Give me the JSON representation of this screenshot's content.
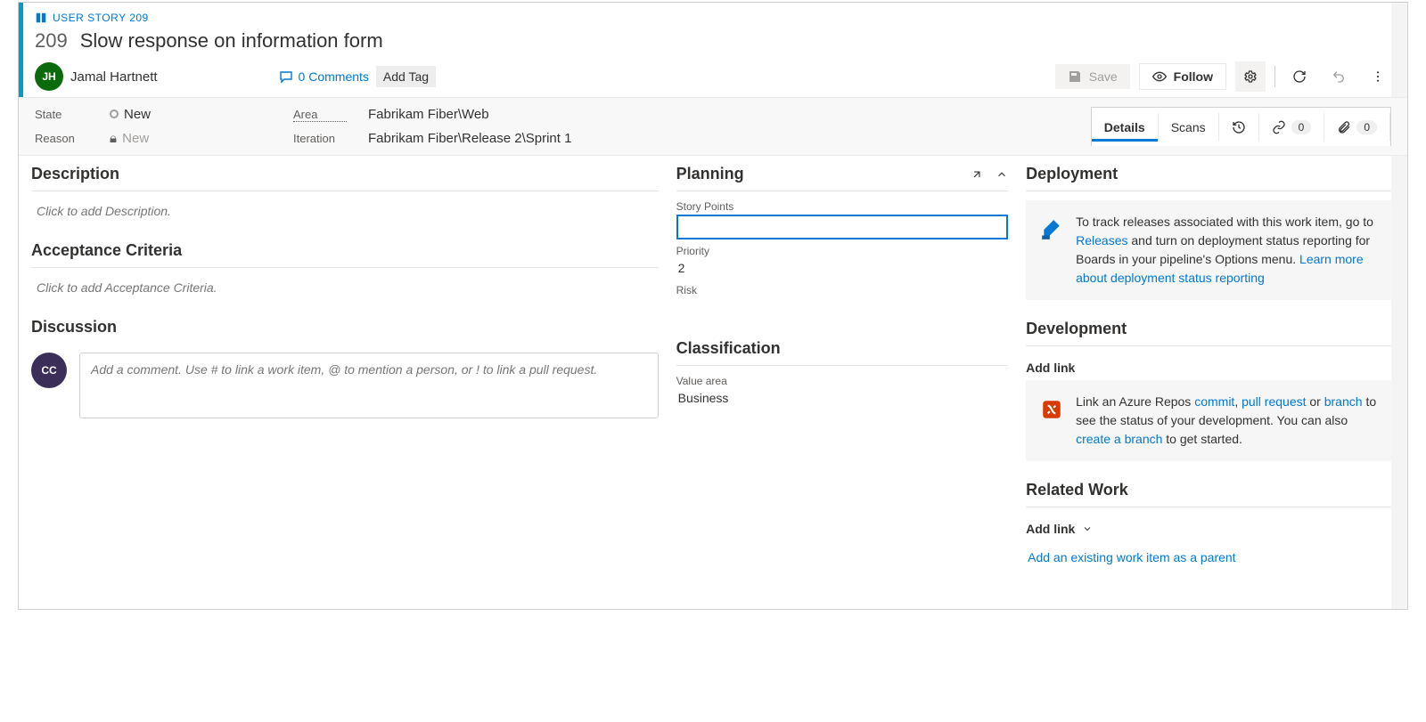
{
  "header": {
    "type_label": "USER STORY 209",
    "id": "209",
    "title": "Slow response on information form",
    "assignee": {
      "initials": "JH",
      "name": "Jamal Hartnett"
    },
    "comments_label": "0 Comments",
    "add_tag_label": "Add Tag",
    "toolbar": {
      "save": "Save",
      "follow": "Follow"
    }
  },
  "fields": {
    "state": {
      "label": "State",
      "value": "New"
    },
    "reason": {
      "label": "Reason",
      "value": "New"
    },
    "area": {
      "label": "Area",
      "value": "Fabrikam Fiber\\Web"
    },
    "iteration": {
      "label": "Iteration",
      "value": "Fabrikam Fiber\\Release 2\\Sprint 1"
    }
  },
  "tabs": {
    "details": "Details",
    "scans": "Scans",
    "links_count": "0",
    "attachments_count": "0"
  },
  "left": {
    "description": {
      "heading": "Description",
      "placeholder": "Click to add Description."
    },
    "acceptance": {
      "heading": "Acceptance Criteria",
      "placeholder": "Click to add Acceptance Criteria."
    },
    "discussion": {
      "heading": "Discussion",
      "avatar_initials": "CC",
      "placeholder": "Add a comment. Use # to link a work item, @ to mention a person, or ! to link a pull request."
    }
  },
  "mid": {
    "planning": {
      "heading": "Planning",
      "story_points": {
        "label": "Story Points",
        "value": ""
      },
      "priority": {
        "label": "Priority",
        "value": "2"
      },
      "risk": {
        "label": "Risk",
        "value": ""
      }
    },
    "classification": {
      "heading": "Classification",
      "value_area": {
        "label": "Value area",
        "value": "Business"
      }
    }
  },
  "right": {
    "deployment": {
      "heading": "Deployment",
      "text_prefix": "To track releases associated with this work item, go to ",
      "link1": "Releases",
      "text_mid": " and turn on deployment status reporting for Boards in your pipeline's Options menu. ",
      "link2": "Learn more about deployment status reporting"
    },
    "development": {
      "heading": "Development",
      "addlink": "Add link",
      "text_prefix": "Link an Azure Repos ",
      "commit": "commit",
      "comma": ", ",
      "pr": "pull request",
      "or": " or ",
      "branch": "branch",
      "text_mid": " to see the status of your development. You can also ",
      "create": "create a branch",
      "text_end": " to get started."
    },
    "related": {
      "heading": "Related Work",
      "addlink": "Add link",
      "existing": "Add an existing work item as a parent"
    }
  }
}
